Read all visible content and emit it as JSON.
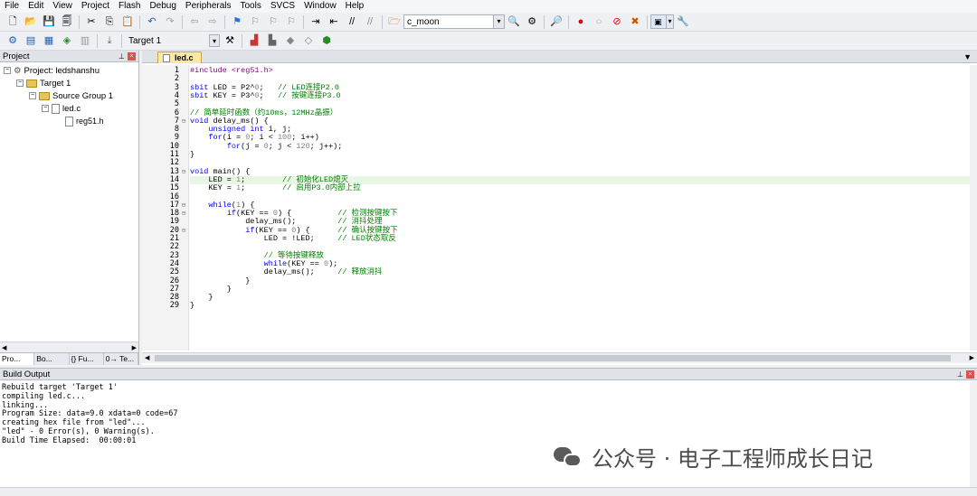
{
  "menu": [
    "File",
    "Edit",
    "View",
    "Project",
    "Flash",
    "Debug",
    "Peripherals",
    "Tools",
    "SVCS",
    "Window",
    "Help"
  ],
  "toolbar": {
    "function_combo": "c_moon",
    "target_combo": "Target 1"
  },
  "project_panel": {
    "title": "Project",
    "tree": [
      {
        "label": "Project: ledshanshu",
        "level": 0,
        "kind": "project"
      },
      {
        "label": "Target 1",
        "level": 1,
        "kind": "target"
      },
      {
        "label": "Source Group 1",
        "level": 2,
        "kind": "folder"
      },
      {
        "label": "led.c",
        "level": 3,
        "kind": "file"
      },
      {
        "label": "reg51.h",
        "level": 4,
        "kind": "file"
      }
    ],
    "tabs": [
      "Pro...",
      "Bo...",
      "{} Fu...",
      "0→ Te..."
    ]
  },
  "editor": {
    "tab": "led.c",
    "lines": [
      "#include <reg51.h>",
      "",
      "sbit LED = P2^0;   // LED连接P2.0",
      "sbit KEY = P3^0;   // 按键连接P3.0",
      "",
      "// 简单延时函数（约10ms，12MHz晶振）",
      "void delay_ms() {",
      "    unsigned int i, j;",
      "    for(i = 0; i < 100; i++)",
      "        for(j = 0; j < 120; j++);",
      "}",
      "",
      "void main() {",
      "    LED = 1;        // 初始化LED熄灭",
      "    KEY = 1;        // 启用P3.0内部上拉",
      "",
      "    while(1) {",
      "        if(KEY == 0) {          // 检测按键按下",
      "            delay_ms();         // 消抖处理",
      "            if(KEY == 0) {      // 确认按键按下",
      "                LED = !LED;     // LED状态取反",
      "",
      "                // 等待按键释放",
      "                while(KEY == 0);",
      "                delay_ms();     // 释放消抖",
      "            }",
      "        }",
      "    }",
      "}"
    ],
    "current_line": 14
  },
  "build_output": {
    "title": "Build Output",
    "lines": [
      "Rebuild target 'Target 1'",
      "compiling led.c...",
      "linking...",
      "Program Size: data=9.0 xdata=0 code=67",
      "creating hex file from \"led\"...",
      "\"led\" - 0 Error(s), 0 Warning(s).",
      "Build Time Elapsed:  00:00:01"
    ]
  },
  "watermark": "公众号 · 电子工程师成长日记"
}
